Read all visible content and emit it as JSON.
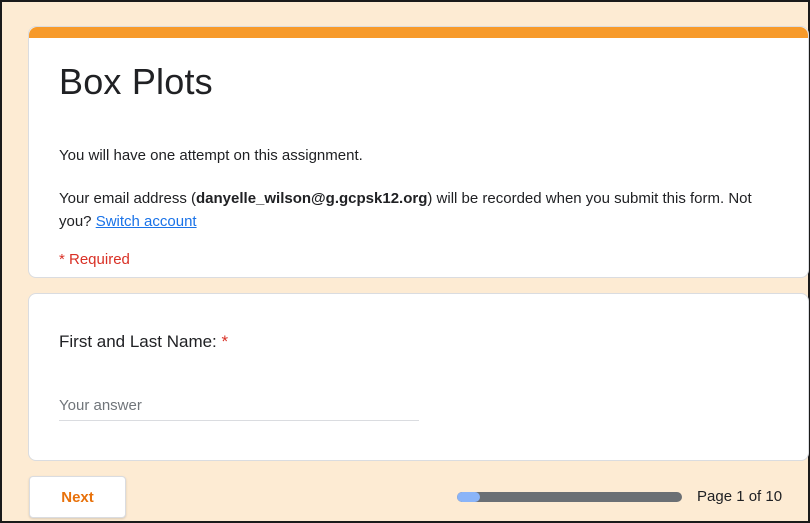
{
  "form": {
    "title": "Box Plots",
    "attempt_notice": "You will have one attempt on this assignment.",
    "email_prefix": "Your email address (",
    "email": "danyelle_wilson@g.gcpsk12.org",
    "email_suffix": ") will be recorded when you submit this form. Not you? ",
    "switch_account": "Switch account",
    "required_note": "* Required"
  },
  "question": {
    "label": "First and Last Name:",
    "required_mark": "*",
    "placeholder": "Your answer",
    "value": ""
  },
  "footer": {
    "next_label": "Next",
    "page_indicator": "Page 1 of 10",
    "progress_fraction": 0.1
  },
  "colors": {
    "accent": "#f79a2a",
    "background": "#fdebd3",
    "link": "#1a73e8",
    "required": "#d93025",
    "button_text": "#e8710a"
  }
}
